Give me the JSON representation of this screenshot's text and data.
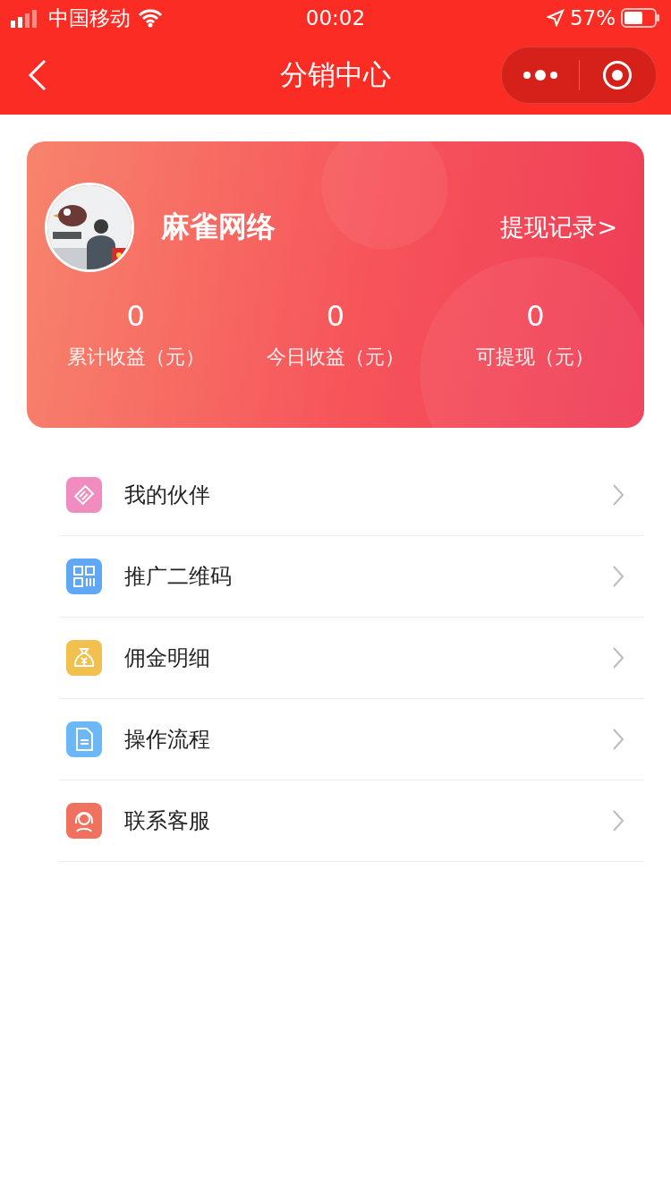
{
  "status_bar": {
    "carrier": "中国移动",
    "time": "00:02",
    "battery": "57%"
  },
  "nav_bar": {
    "title": "分销中心"
  },
  "profile": {
    "name": "麻雀网络",
    "link": "提现记录>"
  },
  "stats": [
    {
      "value": "0",
      "label": "累计收益（元）"
    },
    {
      "value": "0",
      "label": "今日收益（元）"
    },
    {
      "value": "0",
      "label": "可提现（元）"
    }
  ],
  "menu": [
    {
      "label": "我的伙伴",
      "kind": "handshake",
      "color": "#f08cc0"
    },
    {
      "label": "推广二维码",
      "kind": "qrcode",
      "color": "#5ea8f5"
    },
    {
      "label": "佣金明细",
      "kind": "moneybag",
      "color": "#f2c04e"
    },
    {
      "label": "操作流程",
      "kind": "document",
      "color": "#6cb8f7"
    },
    {
      "label": "联系客服",
      "kind": "headset",
      "color": "#f0725e"
    }
  ]
}
